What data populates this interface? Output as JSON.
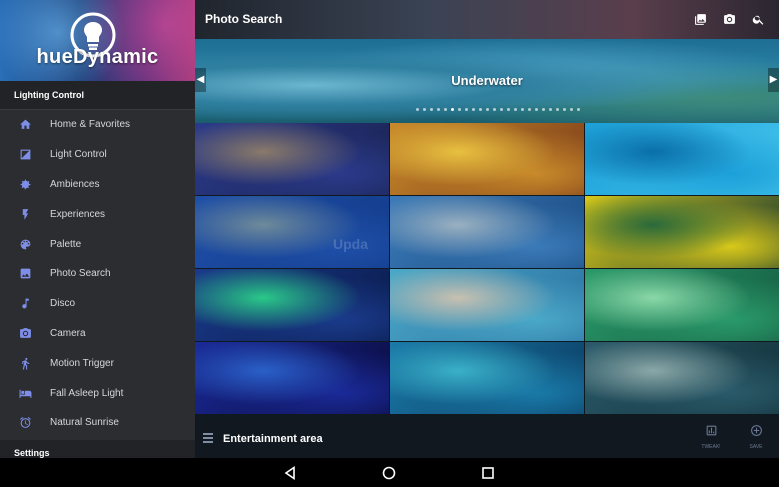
{
  "drawer": {
    "brand": "hueDynamic",
    "section_lighting": "Lighting Control",
    "section_settings": "Settings",
    "items": [
      {
        "label": "Home & Favorites",
        "icon": "home-icon"
      },
      {
        "label": "Light Control",
        "icon": "light-control-icon"
      },
      {
        "label": "Ambiences",
        "icon": "ambiences-icon"
      },
      {
        "label": "Experiences",
        "icon": "flash-icon"
      },
      {
        "label": "Palette",
        "icon": "palette-icon"
      },
      {
        "label": "Photo Search",
        "icon": "photo-icon"
      },
      {
        "label": "Disco",
        "icon": "music-note-icon"
      },
      {
        "label": "Camera",
        "icon": "camera-icon"
      },
      {
        "label": "Motion Trigger",
        "icon": "walk-icon"
      },
      {
        "label": "Fall Asleep Light",
        "icon": "bed-icon"
      },
      {
        "label": "Natural Sunrise",
        "icon": "alarm-icon"
      }
    ]
  },
  "topbar": {
    "title": "Photo Search",
    "actions": [
      "gallery-icon",
      "camera-icon",
      "search-icon"
    ]
  },
  "banner": {
    "title": "Underwater",
    "dot_count": 24,
    "active_dot": 5
  },
  "watermark": "Upda",
  "tiles": [
    {
      "name": "moray-eel-tile",
      "colors": [
        "#2a3a8a",
        "#8a7a6a",
        "#1a2250"
      ]
    },
    {
      "name": "koi-fish-tile",
      "colors": [
        "#c88a2a",
        "#e8c040",
        "#7a3a1a"
      ]
    },
    {
      "name": "water-drops-tile",
      "colors": [
        "#1ca0d8",
        "#0a6fa8",
        "#45c4ec"
      ]
    },
    {
      "name": "stingray-tile",
      "colors": [
        "#1e4fa8",
        "#6e8a9a",
        "#123a88"
      ]
    },
    {
      "name": "shark-tile",
      "colors": [
        "#3a7ab8",
        "#9ab0c0",
        "#1a4a80"
      ]
    },
    {
      "name": "yellow-fish-tile",
      "colors": [
        "#d8c81a",
        "#2a6a3a",
        "#1a3a30"
      ]
    },
    {
      "name": "coral-reef-tile",
      "colors": [
        "#1a3a8a",
        "#2ac888",
        "#0a1a4a"
      ]
    },
    {
      "name": "reef-fish-tile",
      "colors": [
        "#4aa8c8",
        "#c8c0b0",
        "#2a70a0"
      ]
    },
    {
      "name": "green-pattern-tile",
      "colors": [
        "#2a9a6a",
        "#8ad8a8",
        "#145a40"
      ]
    },
    {
      "name": "vortex-tile",
      "colors": [
        "#1a2a98",
        "#2a60c8",
        "#0a0a3a"
      ]
    },
    {
      "name": "ocean-surface-tile",
      "colors": [
        "#1a7aa8",
        "#3ab0c8",
        "#0a3a60"
      ]
    },
    {
      "name": "rope-texture-tile",
      "colors": [
        "#2a5a6a",
        "#8aa8a8",
        "#123038"
      ]
    }
  ],
  "bottombar": {
    "title": "Entertainment area",
    "tweak_label": "TWEAK!",
    "save_label": "SAVE"
  },
  "colors": {
    "drawer_bg": "#2b2d30",
    "accent": "#7e8ee8"
  }
}
